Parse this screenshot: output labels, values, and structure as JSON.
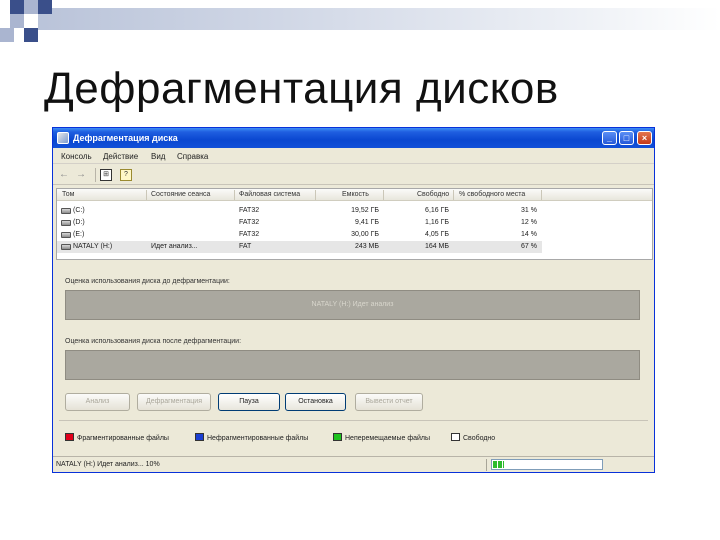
{
  "slide": {
    "title": "Дефрагментация дисков"
  },
  "window": {
    "title": "Дефрагментация диска",
    "buttons": {
      "minimize": "_",
      "maximize": "□",
      "close": "×"
    }
  },
  "menu": [
    "Консоль",
    "Действие",
    "Вид",
    "Справка"
  ],
  "toolbar": {
    "back": "←",
    "forward": "→",
    "view": "⊞",
    "properties": "?"
  },
  "volumes": {
    "columns": [
      "Том",
      "Состояние сеанса",
      "Файловая система",
      "Емкость",
      "Свободно",
      "% свободного места"
    ],
    "rows": [
      {
        "name": "(C:)",
        "status": "",
        "fs": "FAT32",
        "capacity": "19,52 ГБ",
        "free": "6,16 ГБ",
        "percent": "31 %",
        "selected": false
      },
      {
        "name": "(D:)",
        "status": "",
        "fs": "FAT32",
        "capacity": "9,41 ГБ",
        "free": "1,16 ГБ",
        "percent": "12 %",
        "selected": false
      },
      {
        "name": "(E:)",
        "status": "",
        "fs": "FAT32",
        "capacity": "30,00 ГБ",
        "free": "4,05 ГБ",
        "percent": "14 %",
        "selected": false
      },
      {
        "name": "NATALY (H:)",
        "status": "Идет анализ...",
        "fs": "FAT",
        "capacity": "243 МБ",
        "free": "164 МБ",
        "percent": "67 %",
        "selected": true
      }
    ]
  },
  "analysis": {
    "before_label": "Оценка использования диска до дефрагментации:",
    "before_text": "NATALY (H:) Идет анализ",
    "after_label": "Оценка использования диска после дефрагментации:"
  },
  "actions": {
    "analyze": "Анализ",
    "defragment": "Дефрагментация",
    "pause": "Пауза",
    "stop": "Остановка",
    "report": "Вывести отчет"
  },
  "legend": [
    {
      "label": "Фрагментированные файлы",
      "color": "#e0001b"
    },
    {
      "label": "Нефрагментированные файлы",
      "color": "#1c3fd2"
    },
    {
      "label": "Неперемещаемые файлы",
      "color": "#1ec21e"
    },
    {
      "label": "Свободно",
      "color": "#ffffff"
    }
  ],
  "status": {
    "text": "NATALY (H:) Идет анализ... 10%",
    "progress": 0.1
  }
}
